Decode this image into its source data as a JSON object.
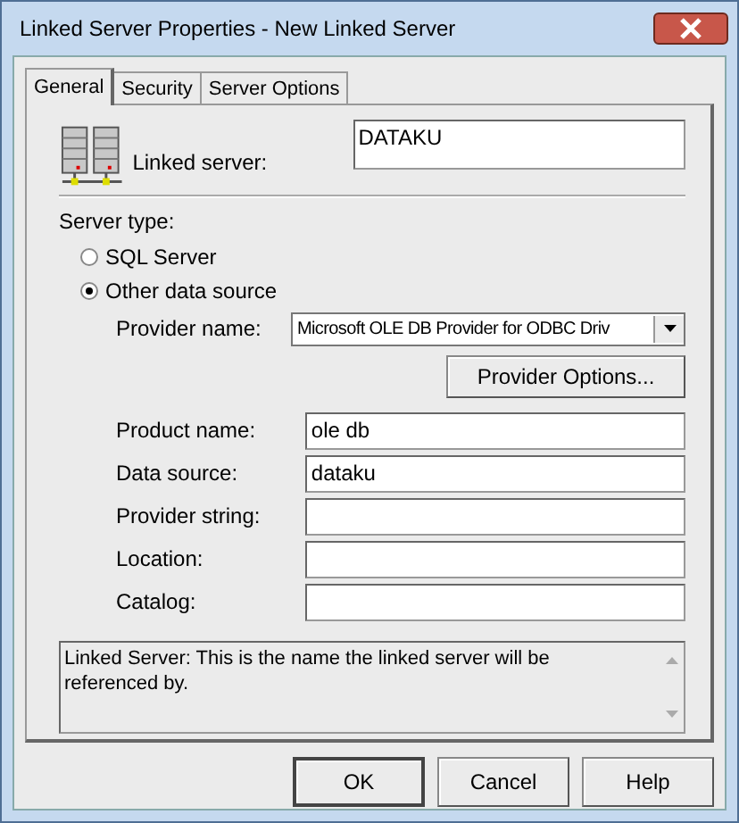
{
  "window": {
    "title": "Linked Server Properties - New Linked Server"
  },
  "tabs": [
    {
      "label": "General",
      "selected": true
    },
    {
      "label": "Security",
      "selected": false
    },
    {
      "label": "Server Options",
      "selected": false
    }
  ],
  "linked_server": {
    "label": "Linked server:",
    "value": "DATAKU"
  },
  "server_type": {
    "label": "Server type:",
    "options": [
      {
        "label": "SQL Server",
        "selected": false
      },
      {
        "label": "Other data source",
        "selected": true
      }
    ]
  },
  "provider": {
    "label": "Provider name:",
    "value": "Microsoft OLE DB Provider for ODBC Driv"
  },
  "provider_options_button": "Provider Options...",
  "fields": [
    {
      "label": "Product name:",
      "value": "ole db"
    },
    {
      "label": "Data source:",
      "value": "dataku"
    },
    {
      "label": "Provider string:"
    },
    {
      "label": "Location:"
    },
    {
      "label": "Catalog:"
    }
  ],
  "description": "Linked  Server: This is the name the linked server will be referenced by.",
  "buttons": [
    "OK",
    "Cancel",
    "Help"
  ]
}
